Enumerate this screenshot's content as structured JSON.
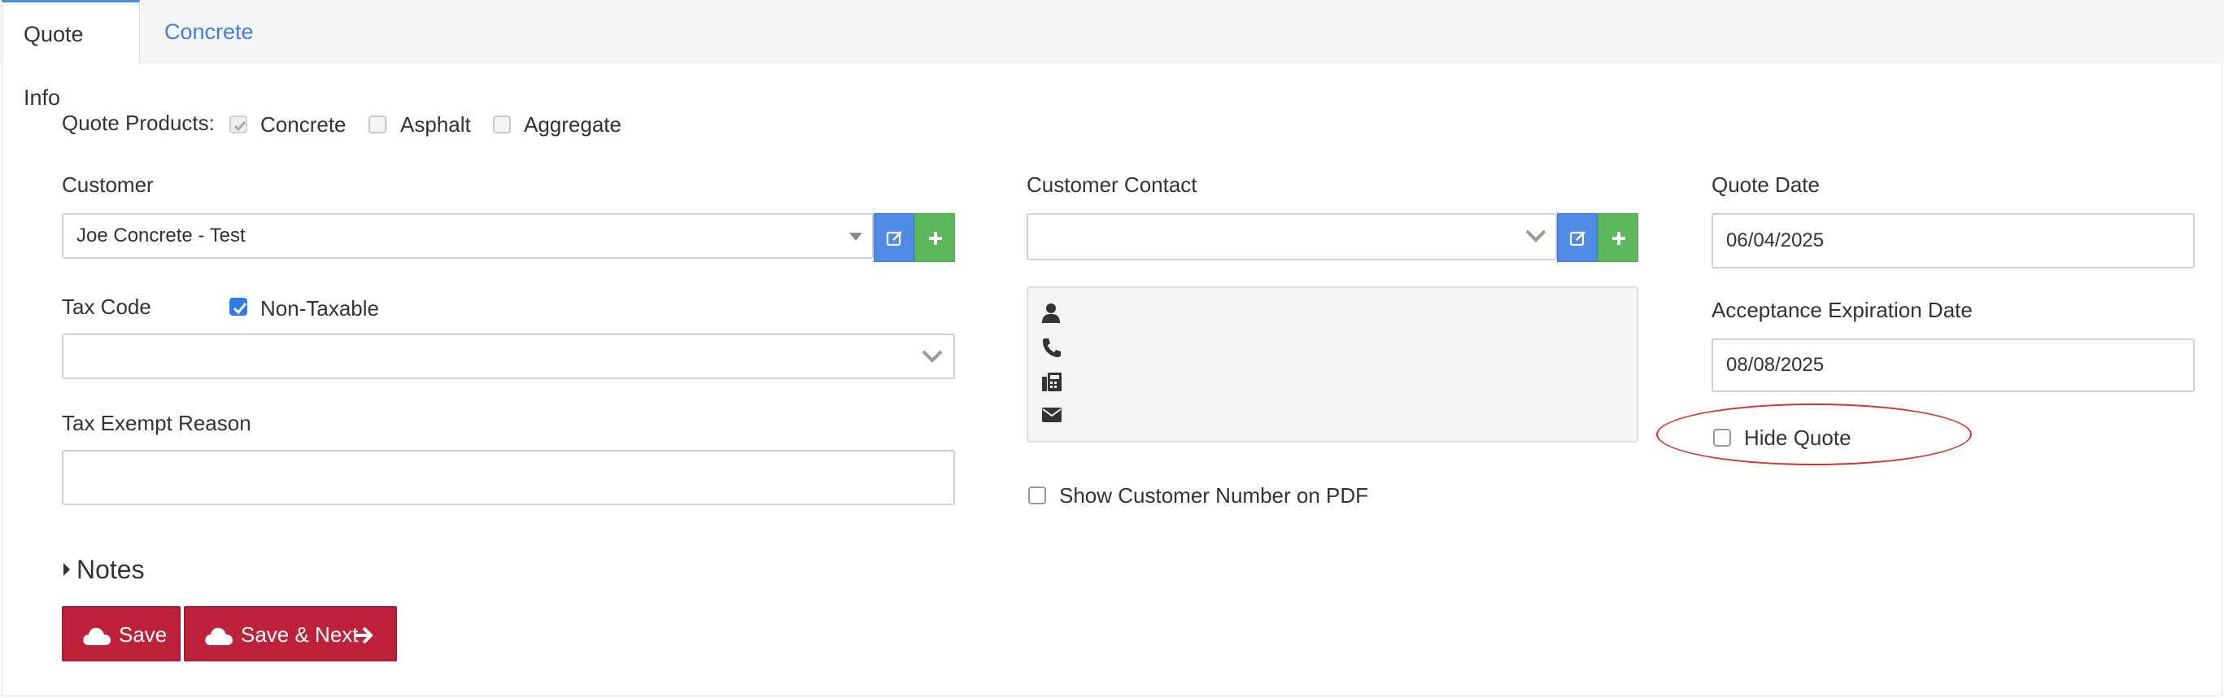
{
  "tabs": [
    {
      "label": "Quote Info",
      "active": true
    },
    {
      "label": "Concrete",
      "active": false
    }
  ],
  "quote_products": {
    "label": "Quote Products:",
    "options": [
      {
        "label": "Concrete",
        "checked": true,
        "disabled": true
      },
      {
        "label": "Asphalt",
        "checked": false,
        "disabled": true
      },
      {
        "label": "Aggregate",
        "checked": false,
        "disabled": true
      }
    ]
  },
  "customer": {
    "label": "Customer",
    "value": "Joe Concrete - Test"
  },
  "tax_code": {
    "label": "Tax Code",
    "non_taxable_label": "Non-Taxable",
    "non_taxable_checked": true,
    "value": ""
  },
  "tax_exempt_reason": {
    "label": "Tax Exempt Reason",
    "value": ""
  },
  "customer_contact": {
    "label": "Customer Contact",
    "value": "",
    "details_icons": [
      "user-icon",
      "phone-icon",
      "fax-icon",
      "envelope-icon"
    ]
  },
  "show_customer_number": {
    "label": "Show Customer Number on PDF",
    "checked": false
  },
  "quote_date": {
    "label": "Quote Date",
    "value": "06/04/2025"
  },
  "acceptance_expiration": {
    "label": "Acceptance Expiration Date",
    "value": "08/08/2025"
  },
  "hide_quote": {
    "label": "Hide Quote",
    "checked": false
  },
  "notes": {
    "label": "Notes"
  },
  "buttons": {
    "save": "Save",
    "save_next": "Save & Next"
  },
  "colors": {
    "accent_blue": "#4f8be6",
    "add_green": "#5cb85c",
    "save_red": "#c0213a",
    "tab_link": "#3f7fe0",
    "highlight_ellipse": "#d9342b"
  }
}
